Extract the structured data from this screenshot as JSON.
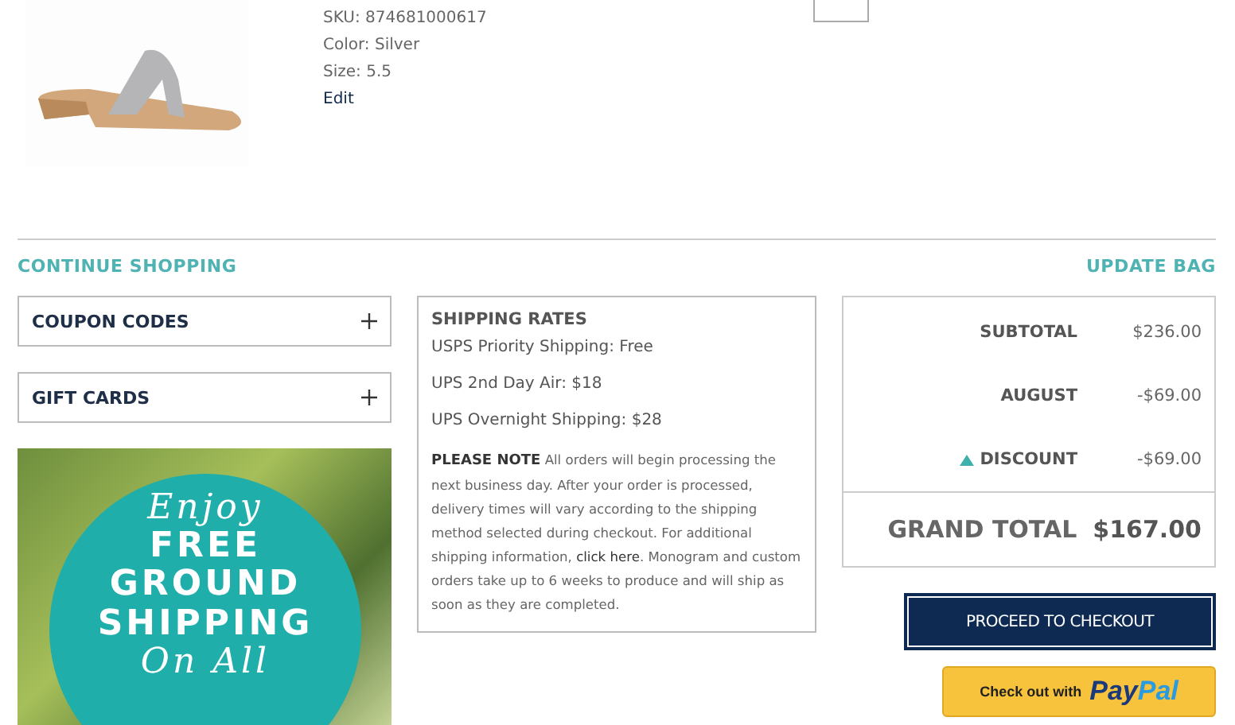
{
  "product": {
    "sku": "SKU: 874681000617",
    "color_line": "Color: Silver",
    "size": "Size: 5.5",
    "edit": "Edit"
  },
  "actions": {
    "continue": "CONTINUE SHOPPING",
    "update": "UPDATE BAG"
  },
  "panels": [
    {
      "label": "COUPON CODES",
      "expanded": false
    },
    {
      "label": "GIFT CARDS",
      "expanded": false
    }
  ],
  "banner": {
    "lines": [
      {
        "text": "Enjoy",
        "kind": "script"
      },
      {
        "text": "FREE",
        "kind": "caps"
      },
      {
        "text": "GROUND",
        "kind": "caps"
      },
      {
        "text": "SHIPPING",
        "kind": "caps"
      },
      {
        "text": "On All",
        "kind": "script"
      }
    ]
  },
  "shipping": {
    "title": "SHIPPING RATES",
    "rates": [
      "USPS Priority Shipping: Free",
      "UPS 2nd Day Air: $18",
      "UPS Overnight Shipping: $28"
    ],
    "note_before": "**PLEASE NOTE** All orders will begin processing the next business day. After your order is processed, delivery times will vary according to the shipping method selected during checkout. For additional shipping information,",
    "note_link": "click here",
    "note_after": ". Monogram and custom orders take up to 6 weeks to produce and will ship as soon as they are completed."
  },
  "summary": {
    "rows": [
      {
        "label": "SUBTOTAL",
        "value": "$236.00"
      },
      {
        "label": "AUGUST",
        "value": "-$69.00"
      },
      {
        "label": "DISCOUNT",
        "value": "-$69.00",
        "expanded": true
      }
    ],
    "total_label": "GRAND TOTAL",
    "total_value": "$167.00"
  },
  "checkout": "PROCEED TO CHECKOUT",
  "paypal": {
    "prefix": "Check out with",
    "brand_1": "Pay",
    "brand_2": "Pal"
  }
}
